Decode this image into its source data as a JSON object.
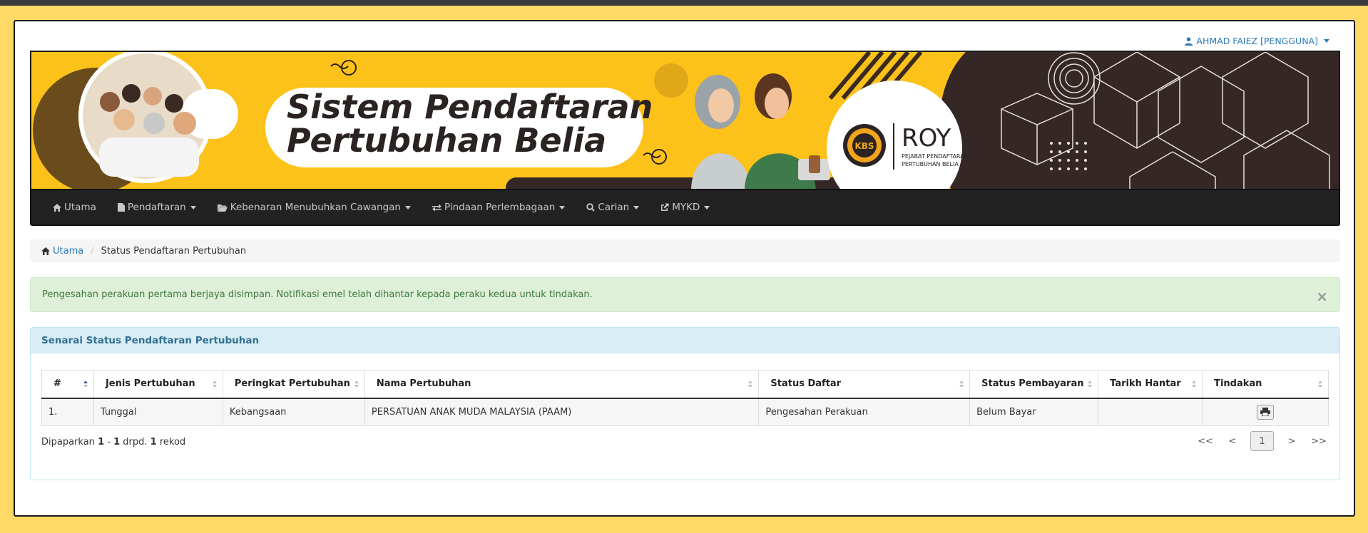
{
  "user": {
    "label": "AHMAD FAIEZ [PENGGUNA]"
  },
  "banner": {
    "title_line1": "Sistem  Pendaftaran",
    "title_line2": "Pertubuhan Belia",
    "logo_badge": "KBS",
    "logo_name": "ROY",
    "logo_sub1": "PEJABAT PENDAFTARAN",
    "logo_sub2": "PERTUBUHAN BELIA"
  },
  "nav": [
    {
      "label": "Utama",
      "icon": "home-icon",
      "dropdown": false
    },
    {
      "label": "Pendaftaran",
      "icon": "file-icon",
      "dropdown": true
    },
    {
      "label": "Kebenaran Menubuhkan Cawangan",
      "icon": "folder-open-icon",
      "dropdown": true
    },
    {
      "label": "Pindaan Perlembagaan",
      "icon": "transfer-icon",
      "dropdown": true
    },
    {
      "label": "Carian",
      "icon": "search-icon",
      "dropdown": true
    },
    {
      "label": "MYKD",
      "icon": "share-icon",
      "dropdown": true
    }
  ],
  "breadcrumb": {
    "home": "Utama",
    "current": "Status Pendaftaran Pertubuhan"
  },
  "alert": {
    "message": "Pengesahan perakuan pertama berjaya disimpan. Notifikasi emel telah dihantar kepada peraku kedua untuk tindakan.",
    "close": "×"
  },
  "panel": {
    "title": "Senarai Status Pendaftaran Pertubuhan"
  },
  "table": {
    "columns": [
      "#",
      "Jenis Pertubuhan",
      "Peringkat Pertubuhan",
      "Nama Pertubuhan",
      "Status Daftar",
      "Status Pembayaran",
      "Tarikh Hantar",
      "Tindakan"
    ],
    "rows": [
      {
        "no": "1.",
        "jenis": "Tunggal",
        "peringkat": "Kebangsaan",
        "nama": "PERSATUAN ANAK MUDA MALAYSIA (PAAM)",
        "status_daftar": "Pengesahan Perakuan",
        "status_bayar": "Belum Bayar",
        "tarikh": ""
      }
    ]
  },
  "footer": {
    "prefix": "Dipaparkan",
    "from": "1",
    "dash": "-",
    "to": "1",
    "mid": "drpd.",
    "total": "1",
    "suffix": "rekod"
  },
  "pager": {
    "first": "<<",
    "prev": "<",
    "current": "1",
    "next": ">",
    "last": ">>"
  }
}
